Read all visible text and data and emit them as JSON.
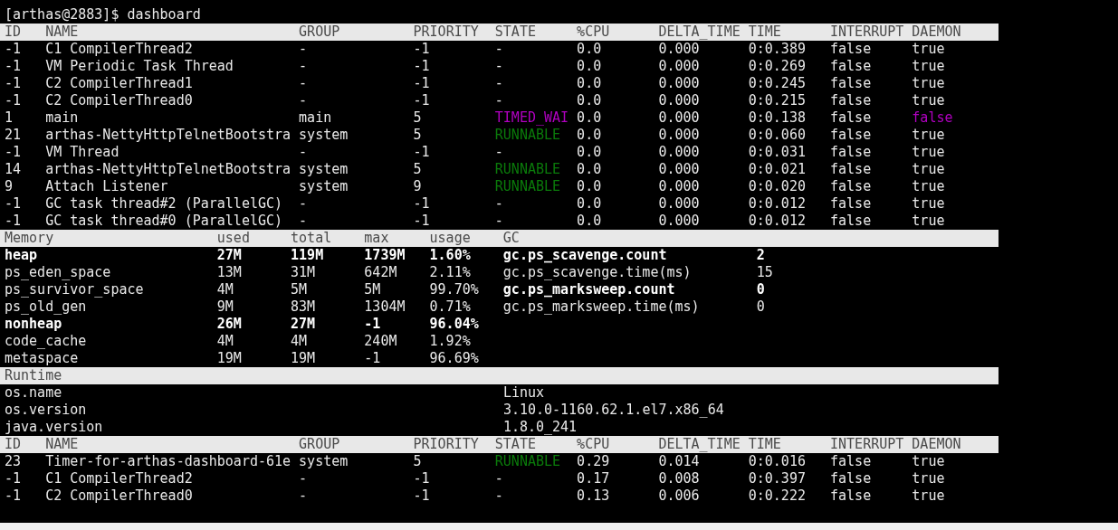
{
  "prompt": {
    "user_host": "[arthas@2883]$",
    "command": "dashboard"
  },
  "threads": {
    "columns": [
      "ID",
      "NAME",
      "GROUP",
      "PRIORITY",
      "STATE",
      "%CPU",
      "DELTA_TIME",
      "TIME",
      "INTERRUPT",
      "DAEMON"
    ],
    "rows": [
      {
        "id": "-1",
        "name": "C1 CompilerThread2",
        "group": "-",
        "priority": "-1",
        "state": {
          "text": "-",
          "color": "#e8e8e8"
        },
        "cpu": "0.0",
        "delta_time": "0.000",
        "time": "0:0.389",
        "interrupt": "false",
        "daemon": {
          "text": "true",
          "color": "#e8e8e8"
        }
      },
      {
        "id": "-1",
        "name": "VM Periodic Task Thread",
        "group": "-",
        "priority": "-1",
        "state": {
          "text": "-",
          "color": "#e8e8e8"
        },
        "cpu": "0.0",
        "delta_time": "0.000",
        "time": "0:0.269",
        "interrupt": "false",
        "daemon": {
          "text": "true",
          "color": "#e8e8e8"
        }
      },
      {
        "id": "-1",
        "name": "C2 CompilerThread1",
        "group": "-",
        "priority": "-1",
        "state": {
          "text": "-",
          "color": "#e8e8e8"
        },
        "cpu": "0.0",
        "delta_time": "0.000",
        "time": "0:0.245",
        "interrupt": "false",
        "daemon": {
          "text": "true",
          "color": "#e8e8e8"
        }
      },
      {
        "id": "-1",
        "name": "C2 CompilerThread0",
        "group": "-",
        "priority": "-1",
        "state": {
          "text": "-",
          "color": "#e8e8e8"
        },
        "cpu": "0.0",
        "delta_time": "0.000",
        "time": "0:0.215",
        "interrupt": "false",
        "daemon": {
          "text": "true",
          "color": "#e8e8e8"
        }
      },
      {
        "id": "1",
        "name": "main",
        "group": "main",
        "priority": "5",
        "state": {
          "text": "TIMED_WAI",
          "color": "#b000c0"
        },
        "cpu": "0.0",
        "delta_time": "0.000",
        "time": "0:0.138",
        "interrupt": "false",
        "daemon": {
          "text": "false",
          "color": "#b000c0"
        }
      },
      {
        "id": "21",
        "name": "arthas-NettyHttpTelnetBootstra",
        "group": "system",
        "priority": "5",
        "state": {
          "text": "RUNNABLE",
          "color": "#0a7a0a"
        },
        "cpu": "0.0",
        "delta_time": "0.000",
        "time": "0:0.060",
        "interrupt": "false",
        "daemon": {
          "text": "true",
          "color": "#e8e8e8"
        }
      },
      {
        "id": "-1",
        "name": "VM Thread",
        "group": "-",
        "priority": "-1",
        "state": {
          "text": "-",
          "color": "#e8e8e8"
        },
        "cpu": "0.0",
        "delta_time": "0.000",
        "time": "0:0.031",
        "interrupt": "false",
        "daemon": {
          "text": "true",
          "color": "#e8e8e8"
        }
      },
      {
        "id": "14",
        "name": "arthas-NettyHttpTelnetBootstra",
        "group": "system",
        "priority": "5",
        "state": {
          "text": "RUNNABLE",
          "color": "#0a7a0a"
        },
        "cpu": "0.0",
        "delta_time": "0.000",
        "time": "0:0.021",
        "interrupt": "false",
        "daemon": {
          "text": "true",
          "color": "#e8e8e8"
        }
      },
      {
        "id": "9",
        "name": "Attach Listener",
        "group": "system",
        "priority": "9",
        "state": {
          "text": "RUNNABLE",
          "color": "#0a7a0a"
        },
        "cpu": "0.0",
        "delta_time": "0.000",
        "time": "0:0.020",
        "interrupt": "false",
        "daemon": {
          "text": "true",
          "color": "#e8e8e8"
        }
      },
      {
        "id": "-1",
        "name": "GC task thread#2 (ParallelGC)",
        "group": "-",
        "priority": "-1",
        "state": {
          "text": "-",
          "color": "#e8e8e8"
        },
        "cpu": "0.0",
        "delta_time": "0.000",
        "time": "0:0.012",
        "interrupt": "false",
        "daemon": {
          "text": "true",
          "color": "#e8e8e8"
        }
      },
      {
        "id": "-1",
        "name": "GC task thread#0 (ParallelGC)",
        "group": "-",
        "priority": "-1",
        "state": {
          "text": "-",
          "color": "#e8e8e8"
        },
        "cpu": "0.0",
        "delta_time": "0.000",
        "time": "0:0.012",
        "interrupt": "false",
        "daemon": {
          "text": "true",
          "color": "#e8e8e8"
        }
      }
    ]
  },
  "memory": {
    "columns": [
      "Memory",
      "used",
      "total",
      "max",
      "usage"
    ],
    "rows": [
      {
        "name": "heap",
        "used": "27M",
        "total": "119M",
        "max": "1739M",
        "usage": "1.60%",
        "bold": true
      },
      {
        "name": "ps_eden_space",
        "used": "13M",
        "total": "31M",
        "max": "642M",
        "usage": "2.11%",
        "bold": false
      },
      {
        "name": "ps_survivor_space",
        "used": "4M",
        "total": "5M",
        "max": "5M",
        "usage": "99.70%",
        "bold": false
      },
      {
        "name": "ps_old_gen",
        "used": "9M",
        "total": "83M",
        "max": "1304M",
        "usage": "0.71%",
        "bold": false
      },
      {
        "name": "nonheap",
        "used": "26M",
        "total": "27M",
        "max": "-1",
        "usage": "96.04%",
        "bold": true
      },
      {
        "name": "code_cache",
        "used": "4M",
        "total": "4M",
        "max": "240M",
        "usage": "1.92%",
        "bold": false
      },
      {
        "name": "metaspace",
        "used": "19M",
        "total": "19M",
        "max": "-1",
        "usage": "96.69%",
        "bold": false
      }
    ]
  },
  "gc": {
    "title": "GC",
    "rows": [
      {
        "name": "gc.ps_scavenge.count",
        "value": "2",
        "bold": true
      },
      {
        "name": "gc.ps_scavenge.time(ms)",
        "value": "15",
        "bold": false
      },
      {
        "name": "gc.ps_marksweep.count",
        "value": "0",
        "bold": true
      },
      {
        "name": "gc.ps_marksweep.time(ms)",
        "value": "0",
        "bold": false
      }
    ]
  },
  "runtime": {
    "title": "Runtime",
    "rows": [
      {
        "name": "os.name",
        "value": "Linux"
      },
      {
        "name": "os.version",
        "value": "3.10.0-1160.62.1.el7.x86_64"
      },
      {
        "name": "java.version",
        "value": "1.8.0_241"
      }
    ]
  },
  "top_threads": {
    "columns": [
      "ID",
      "NAME",
      "GROUP",
      "PRIORITY",
      "STATE",
      "%CPU",
      "DELTA_TIME",
      "TIME",
      "INTERRUPT",
      "DAEMON"
    ],
    "rows": [
      {
        "id": "23",
        "name": "Timer-for-arthas-dashboard-61e",
        "group": "system",
        "priority": "5",
        "state": {
          "text": "RUNNABLE",
          "color": "#0a7a0a"
        },
        "cpu": "0.29",
        "delta_time": "0.014",
        "time": "0:0.016",
        "interrupt": "false",
        "daemon": {
          "text": "true",
          "color": "#e8e8e8"
        }
      },
      {
        "id": "-1",
        "name": "C1 CompilerThread2",
        "group": "-",
        "priority": "-1",
        "state": {
          "text": "-",
          "color": "#e8e8e8"
        },
        "cpu": "0.17",
        "delta_time": "0.008",
        "time": "0:0.397",
        "interrupt": "false",
        "daemon": {
          "text": "true",
          "color": "#e8e8e8"
        }
      },
      {
        "id": "-1",
        "name": "C2 CompilerThread0",
        "group": "-",
        "priority": "-1",
        "state": {
          "text": "-",
          "color": "#e8e8e8"
        },
        "cpu": "0.13",
        "delta_time": "0.006",
        "time": "0:0.222",
        "interrupt": "false",
        "daemon": {
          "text": "true",
          "color": "#e8e8e8"
        }
      }
    ]
  }
}
